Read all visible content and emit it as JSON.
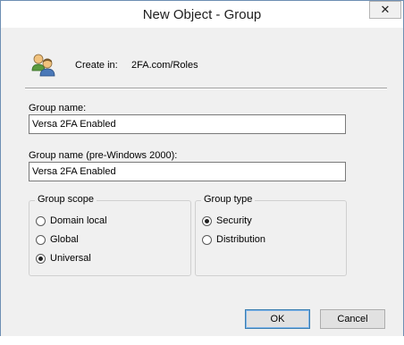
{
  "window": {
    "title": "New Object - Group",
    "close_glyph": "✕"
  },
  "create_in": {
    "label": "Create in:",
    "path": "2FA.com/Roles"
  },
  "fields": {
    "group_name": {
      "label": "Group name:",
      "value": "Versa 2FA Enabled"
    },
    "group_name_pre2000": {
      "label": "Group name (pre-Windows 2000):",
      "value": "Versa 2FA Enabled"
    }
  },
  "group_scope": {
    "legend": "Group scope",
    "options": [
      {
        "label": "Domain local",
        "selected": false
      },
      {
        "label": "Global",
        "selected": false
      },
      {
        "label": "Universal",
        "selected": true
      }
    ]
  },
  "group_type": {
    "legend": "Group type",
    "options": [
      {
        "label": "Security",
        "selected": true
      },
      {
        "label": "Distribution",
        "selected": false
      }
    ]
  },
  "buttons": {
    "ok": "OK",
    "cancel": "Cancel"
  },
  "colors": {
    "accent_border": "#3c7fb1",
    "window_bg": "#f0f0f0"
  },
  "icons": {
    "group": "users-icon",
    "close": "close-icon"
  }
}
